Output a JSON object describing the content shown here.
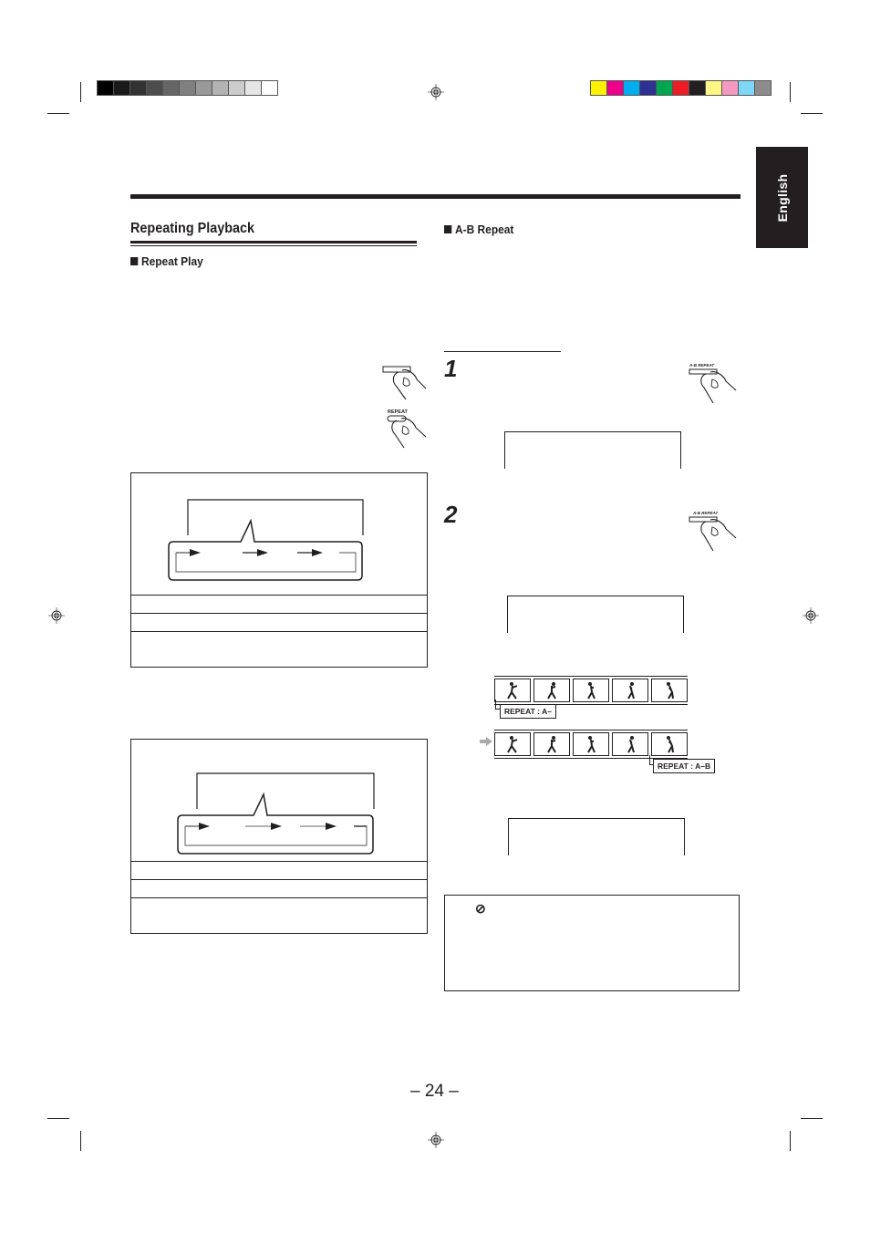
{
  "print_marks": {
    "grayscale_bar": [
      "#000000",
      "#1a1a1a",
      "#333333",
      "#4d4d4d",
      "#666666",
      "#808080",
      "#999999",
      "#b3b3b3",
      "#cccccc",
      "#e6e6e6",
      "#ffffff"
    ],
    "color_bar": [
      "#fff200",
      "#ec008c",
      "#00aeef",
      "#2e3192",
      "#00a651",
      "#ed1c24",
      "#231f20",
      "#fff685",
      "#f49ac1",
      "#7fd6f7",
      "#8c8c8c"
    ]
  },
  "language_tab": {
    "label": "English"
  },
  "left_column": {
    "title": "Repeating Playback",
    "repeat_play": {
      "heading": "Repeat  Play",
      "button_label": "REPEAT"
    }
  },
  "right_column": {
    "ab_repeat": {
      "heading": "A-B Repeat",
      "steps": [
        {
          "number": "1",
          "button_label": "A-B REPEAT"
        },
        {
          "number": "2",
          "button_label": "A-B REPEAT"
        }
      ],
      "tags": {
        "start": "REPEAT : A–",
        "end": "REPEAT : A–B"
      }
    }
  },
  "footer": {
    "page_number": "– 24 –"
  },
  "icons": {
    "prohibited": "⊘"
  }
}
